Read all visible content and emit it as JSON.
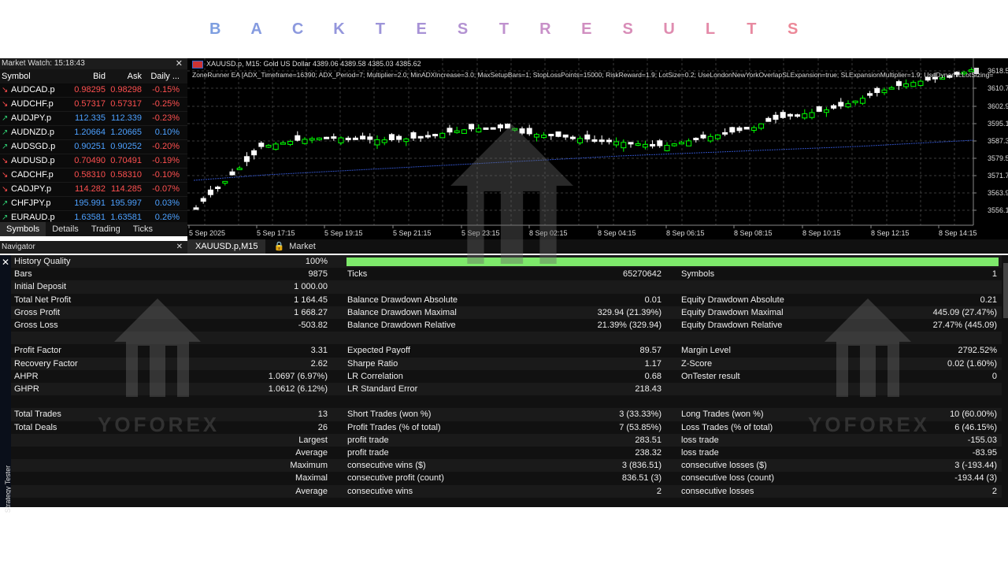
{
  "banner": {
    "letters": [
      {
        "ch": "B",
        "color": "#7d9ee0"
      },
      {
        "ch": "A",
        "color": "#859be0"
      },
      {
        "ch": "C",
        "color": "#8c99de"
      },
      {
        "ch": "K",
        "color": "#9496dc"
      },
      {
        "ch": "T",
        "color": "#9c94d9"
      },
      {
        "ch": "E",
        "color": "#a792d6"
      },
      {
        "ch": "S",
        "color": "#b392d2"
      },
      {
        "ch": "T",
        "color": "#bf91ce"
      },
      {
        "ch": "R",
        "color": "#c890c8"
      },
      {
        "ch": "E",
        "color": "#d08ec0"
      },
      {
        "ch": "S",
        "color": "#d88db8"
      },
      {
        "ch": "U",
        "color": "#df8cb0"
      },
      {
        "ch": "L",
        "color": "#e48aa8"
      },
      {
        "ch": "T",
        "color": "#e889a0"
      },
      {
        "ch": "S",
        "color": "#ec8898"
      }
    ]
  },
  "market_watch": {
    "title": "Market Watch: 15:18:43",
    "close": "✕",
    "headers": [
      "Symbol",
      "Bid",
      "Ask",
      "Daily ..."
    ],
    "rows": [
      {
        "symbol": "AUDCAD.p",
        "bid": "0.98295",
        "ask": "0.98298",
        "daily": "-0.15%",
        "dir": "down"
      },
      {
        "symbol": "AUDCHF.p",
        "bid": "0.57317",
        "ask": "0.57317",
        "daily": "-0.25%",
        "dir": "down"
      },
      {
        "symbol": "AUDJPY.p",
        "bid": "112.335",
        "ask": "112.339",
        "daily": "-0.23%",
        "dir": "up"
      },
      {
        "symbol": "AUDNZD.p",
        "bid": "1.20664",
        "ask": "1.20665",
        "daily": "0.10%",
        "dir": "up"
      },
      {
        "symbol": "AUDSGD.p",
        "bid": "0.90251",
        "ask": "0.90252",
        "daily": "-0.20%",
        "dir": "up"
      },
      {
        "symbol": "AUDUSD.p",
        "bid": "0.70490",
        "ask": "0.70491",
        "daily": "-0.19%",
        "dir": "down"
      },
      {
        "symbol": "CADCHF.p",
        "bid": "0.58310",
        "ask": "0.58310",
        "daily": "-0.10%",
        "dir": "down"
      },
      {
        "symbol": "CADJPY.p",
        "bid": "114.282",
        "ask": "114.285",
        "daily": "-0.07%",
        "dir": "down"
      },
      {
        "symbol": "CHFJPY.p",
        "bid": "195.991",
        "ask": "195.997",
        "daily": "0.03%",
        "dir": "up"
      },
      {
        "symbol": "EURAUD.p",
        "bid": "1.63581",
        "ask": "1.63581",
        "daily": "0.26%",
        "dir": "up"
      }
    ],
    "tabs": [
      "Symbols",
      "Details",
      "Trading",
      "Ticks"
    ]
  },
  "navigator": {
    "title": "Navigator",
    "close": "✕"
  },
  "chart": {
    "info_line": "XAUUSD.p, M15:  Gold US Dollar  4389.06 4389.58 4385.03 4385.62",
    "ea_line": "ZoneRunner EA [ADX_Timeframe=16390; ADX_Period=7; Multiplier=2.0; MinADXIncrease=3.0; MaxSetupBars=1; StopLossPoints=15000; RiskReward=1.9; LotSize=0.2; UseLondonNewYorkOverlapSLExpansion=true; SLExpansionMultiplier=1.9; UseDynamicLotSizing=",
    "price_labels": [
      "3618.50",
      "3610.70",
      "3602.90",
      "3595.10",
      "3587.30",
      "3579.50",
      "3571.70",
      "3563.90",
      "3556.10"
    ],
    "time_labels": [
      "5 Sep 2025",
      "5 Sep 17:15",
      "5 Sep 19:15",
      "5 Sep 21:15",
      "5 Sep 23:15",
      "8 Sep 02:15",
      "8 Sep 04:15",
      "8 Sep 06:15",
      "8 Sep 08:15",
      "8 Sep 10:15",
      "8 Sep 12:15",
      "8 Sep 14:15"
    ],
    "tabs": [
      "XAUUSD.p,M15",
      "Market"
    ],
    "bull_color": "#00ff00",
    "bear_color": "#ffffff",
    "ma_color": "#3050c0"
  },
  "tester": {
    "side_label": "Strategy Tester",
    "close": "✕",
    "rows": [
      [
        "History Quality",
        "100%",
        "",
        "",
        "",
        ""
      ],
      [
        "Bars",
        "9875",
        "Ticks",
        "65270642",
        "Symbols",
        "1"
      ],
      [
        "Initial Deposit",
        "1 000.00",
        "",
        "",
        "",
        ""
      ],
      [
        "Total Net Profit",
        "1 164.45",
        "Balance Drawdown Absolute",
        "0.01",
        "Equity Drawdown Absolute",
        "0.21"
      ],
      [
        "Gross Profit",
        "1 668.27",
        "Balance Drawdown Maximal",
        "329.94 (21.39%)",
        "Equity Drawdown Maximal",
        "445.09 (27.47%)"
      ],
      [
        "Gross Loss",
        "-503.82",
        "Balance Drawdown Relative",
        "21.39% (329.94)",
        "Equity Drawdown Relative",
        "27.47% (445.09)"
      ],
      [
        "",
        "",
        "",
        "",
        "",
        ""
      ],
      [
        "Profit Factor",
        "3.31",
        "Expected Payoff",
        "89.57",
        "Margin Level",
        "2792.52%"
      ],
      [
        "Recovery Factor",
        "2.62",
        "Sharpe Ratio",
        "1.17",
        "Z-Score",
        "0.02 (1.60%)"
      ],
      [
        "AHPR",
        "1.0697 (6.97%)",
        "LR Correlation",
        "0.68",
        "OnTester result",
        "0"
      ],
      [
        "GHPR",
        "1.0612 (6.12%)",
        "LR Standard Error",
        "218.43",
        "",
        ""
      ],
      [
        "",
        "",
        "",
        "",
        "",
        ""
      ],
      [
        "Total Trades",
        "13",
        "Short Trades (won %)",
        "3 (33.33%)",
        "Long Trades (won %)",
        "10 (60.00%)"
      ],
      [
        "Total Deals",
        "26",
        "Profit Trades (% of total)",
        "7 (53.85%)",
        "Loss Trades (% of total)",
        "6 (46.15%)"
      ],
      [
        "",
        "Largest",
        "profit trade",
        "283.51",
        "loss trade",
        "-155.03"
      ],
      [
        "",
        "Average",
        "profit trade",
        "238.32",
        "loss trade",
        "-83.95"
      ],
      [
        "",
        "Maximum",
        "consecutive wins ($)",
        "3 (836.51)",
        "consecutive losses ($)",
        "3 (-193.44)"
      ],
      [
        "",
        "Maximal",
        "consecutive profit (count)",
        "836.51 (3)",
        "consecutive loss (count)",
        "-193.44 (3)"
      ],
      [
        "",
        "Average",
        "consecutive wins",
        "2",
        "consecutive losses",
        "2"
      ]
    ],
    "history_quality_pct": 100,
    "quality_color": "#7ee96b"
  },
  "watermark": {
    "text": "YOFOREX"
  }
}
